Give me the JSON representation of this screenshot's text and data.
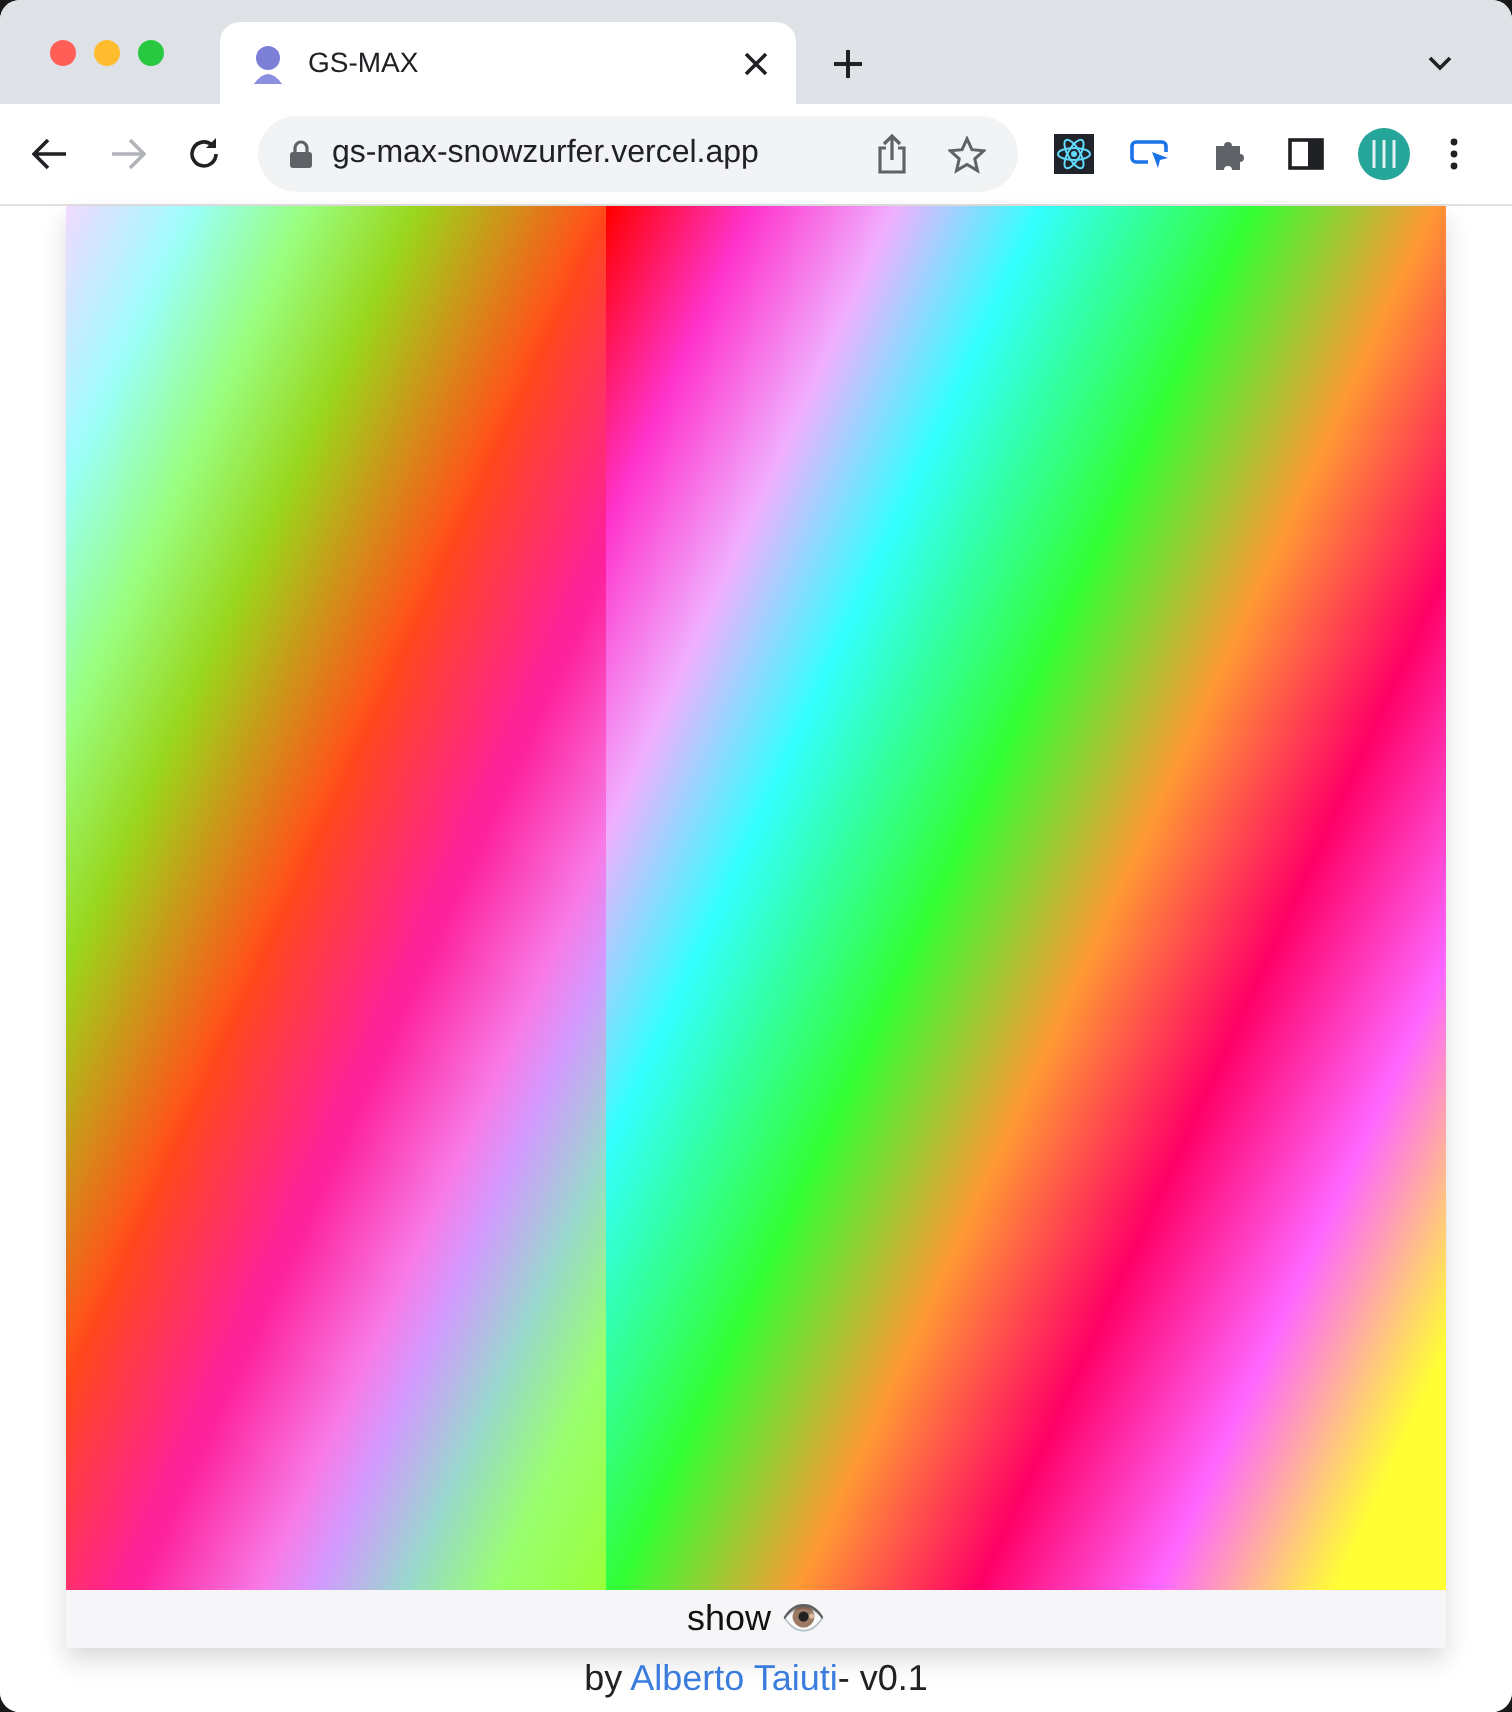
{
  "tab": {
    "title": "GS-MAX",
    "selected": true
  },
  "toolbar": {
    "url": "gs-max-snowzurfer.vercel.app",
    "back_disabled": false,
    "forward_disabled": true
  },
  "page": {
    "show_button": "show 👁️",
    "footer": {
      "prefix": "by ",
      "link": "Alberto Taiuti",
      "suffix": "- v0.1"
    }
  }
}
